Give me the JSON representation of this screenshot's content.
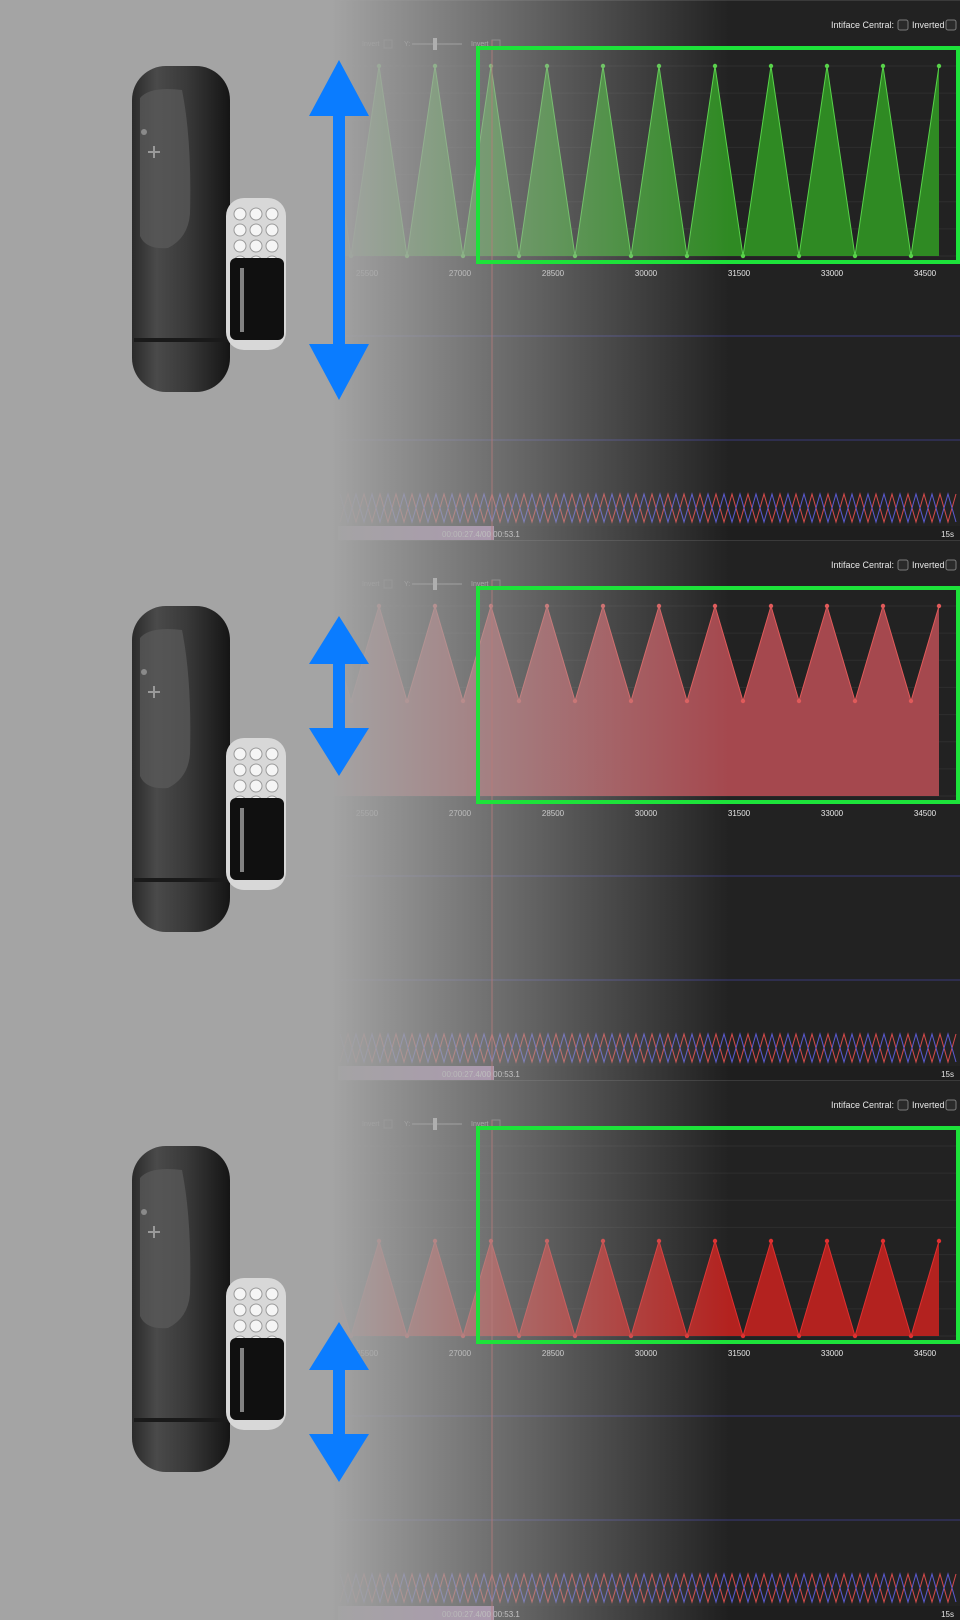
{
  "panels": [
    {
      "id": "full-stroke",
      "intiface_label": "Intiface Central:",
      "inverted_label": "Inverted",
      "toolbar_labels": [
        "Invert",
        "Y:",
        "Invert"
      ],
      "ticks": [
        "25500",
        "27000",
        "28500",
        "30000",
        "31500",
        "33000",
        "34500"
      ],
      "time": "00:00:27.4/00:00:53.1",
      "span": "15s",
      "fill_color": "#2f8a23",
      "point_color": "#58d24a",
      "stroke_level": {
        "top": 1.0,
        "bottom": 0.0
      },
      "arrow_direction": "full-range"
    },
    {
      "id": "upper-stroke",
      "intiface_label": "Intiface Central:",
      "inverted_label": "Inverted",
      "toolbar_labels": [
        "Invert",
        "Y:",
        "Invert"
      ],
      "ticks": [
        "25500",
        "27000",
        "28500",
        "30000",
        "31500",
        "33000",
        "34500"
      ],
      "time": "00:00:27.4/00:00:53.1",
      "span": "15s",
      "fill_color": "#a5484e",
      "point_color": "#e05a5a",
      "stroke_level": {
        "top": 1.0,
        "bottom": 0.5
      },
      "arrow_direction": "upper-range"
    },
    {
      "id": "lower-stroke",
      "intiface_label": "Intiface Central:",
      "inverted_label": "Inverted",
      "toolbar_labels": [
        "Invert",
        "Y:",
        "Invert"
      ],
      "ticks": [
        "25500",
        "27000",
        "28500",
        "30000",
        "31500",
        "33000",
        "34500"
      ],
      "time": "00:00:27.4/00:00:53.1",
      "span": "15s",
      "fill_color": "#b3221f",
      "point_color": "#e03030",
      "stroke_level": {
        "top": 0.5,
        "bottom": 0.0
      },
      "arrow_direction": "lower-range"
    }
  ],
  "colors": {
    "arrow": "#0a7cff",
    "highlight": "#1de23a",
    "background": "#a4a4a4",
    "dark_panel": "#222222",
    "progress": "#b58abd"
  }
}
